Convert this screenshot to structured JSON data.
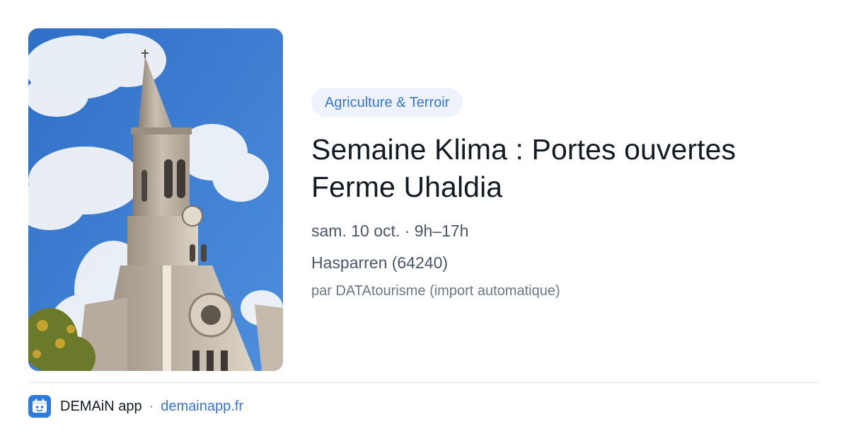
{
  "event": {
    "category": "Agriculture & Terroir",
    "title": "Semaine Klima : Portes ouvertes Ferme Uhaldia",
    "datetime": "sam. 10 oct. · 9h–17h",
    "location": "Hasparren (64240)",
    "source": "par DATAtourisme (import automatique)"
  },
  "photo": {
    "icon": "church-photo"
  },
  "footer": {
    "app_name": "DEMAiN app",
    "separator": "·",
    "link": "demainapp.fr",
    "icon": "demain-app-icon"
  },
  "colors": {
    "accent": "#3a76cf",
    "tag_bg": "#eef3fb",
    "title": "#141a24",
    "meta": "#4a5566",
    "app_icon_bg": "#2e7be0"
  }
}
